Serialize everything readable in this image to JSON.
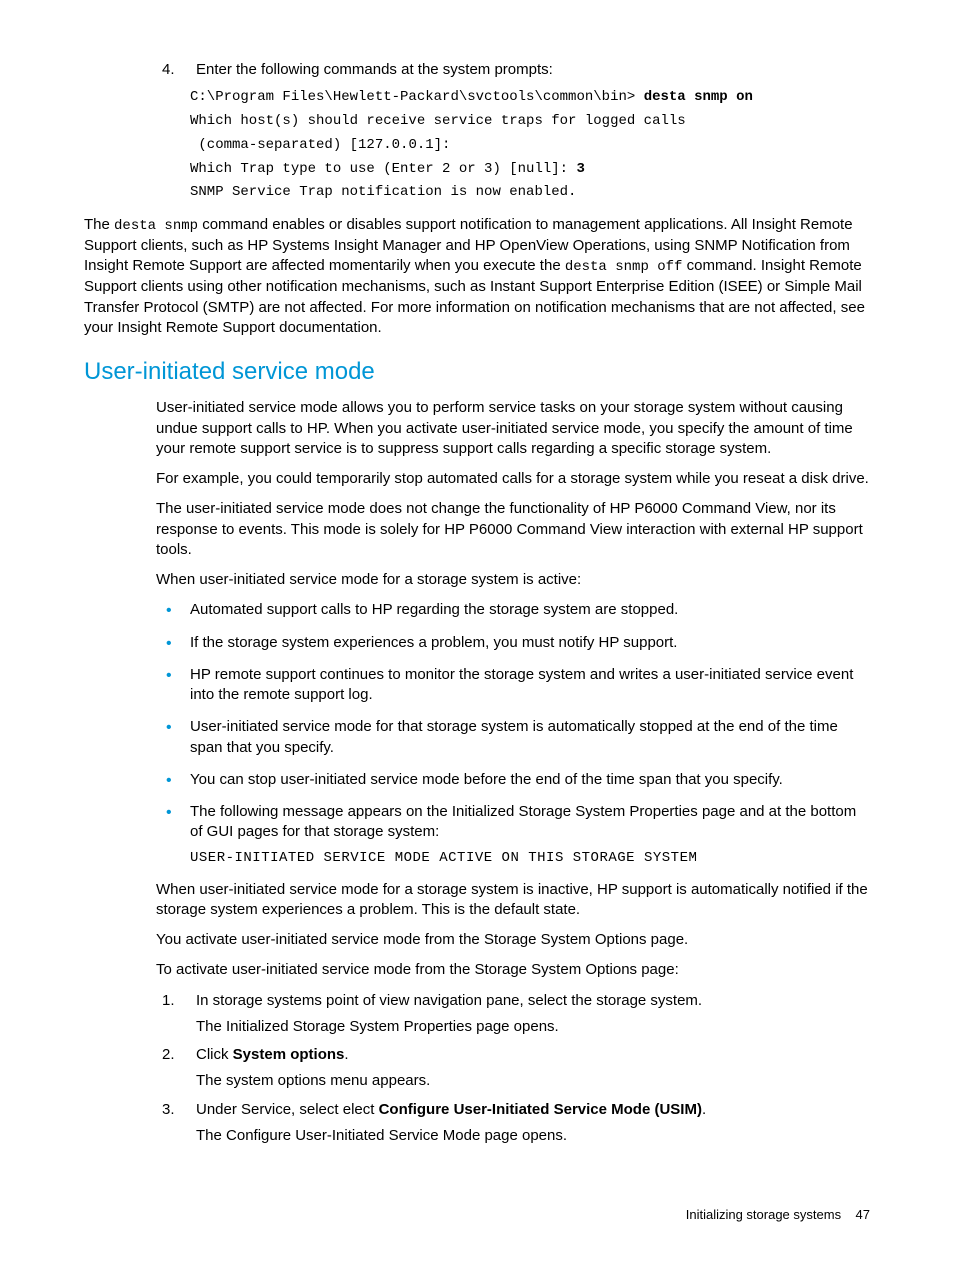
{
  "step4": {
    "num": "4.",
    "text": "Enter the following commands at the system prompts:",
    "code_prompt": "C:\\Program Files\\Hewlett-Packard\\svctools\\common\\bin> ",
    "code_cmd": "desta snmp on",
    "code_line2a": "Which host(s) should receive service traps for logged calls",
    "code_line2b": "(comma-separated) [127.0.0.1]:",
    "code_line3a": "Which Trap type to use (Enter 2 or 3) [null]: ",
    "code_line3b": "3",
    "code_line4": "SNMP Service Trap notification is now enabled."
  },
  "para_desta_1": "The ",
  "para_desta_code1": "desta snmp",
  "para_desta_2": " command enables or disables support notification to management applications. All Insight Remote Support clients, such as HP Systems Insight Manager and HP OpenView Operations, using SNMP Notification from Insight Remote Support are affected momentarily when you execute the ",
  "para_desta_code2": "desta snmp off",
  "para_desta_3": " command. Insight Remote Support clients using other notification mechanisms, such as Instant Support Enterprise Edition (ISEE) or Simple Mail Transfer Protocol (SMTP) are not affected. For more information on notification mechanisms that are not affected, see your Insight Remote Support documentation.",
  "h2": "User-initiated service mode",
  "usim_p1": "User-initiated service mode allows you to perform service tasks on your storage system without causing undue support calls to HP. When you activate user-initiated service mode, you specify the amount of time your remote support service is to suppress support calls regarding a specific storage system.",
  "usim_p2": "For example, you could temporarily stop automated calls for a storage system while you reseat a disk drive.",
  "usim_p3": "The user-initiated service mode does not change the functionality of HP P6000 Command View, nor its response to events. This mode is solely for HP P6000 Command View interaction with external HP support tools.",
  "usim_p4": "When user-initiated service mode for a storage system is active:",
  "bullets": [
    "Automated support calls to HP regarding the storage system are stopped.",
    "If the storage system experiences a problem, you must notify HP support.",
    "HP remote support continues to monitor the storage system and writes a user-initiated service event into the remote support log.",
    "User-initiated service mode for that storage system is automatically stopped at the end of the time span that you specify.",
    "You can stop user-initiated service mode before the end of the time span that you specify."
  ],
  "bullet6_text": "The following message appears on the Initialized Storage System Properties page and at the bottom of GUI pages for that storage system:",
  "bullet6_msg": "USER-INITIATED SERVICE MODE ACTIVE ON THIS STORAGE SYSTEM",
  "usim_p5": "When user-initiated service mode for a storage system is inactive, HP support is automatically notified if the storage system experiences a problem. This is the default state.",
  "usim_p6": "You activate user-initiated service mode from the Storage System Options page.",
  "usim_p7": "To activate user-initiated service mode from the Storage System Options page:",
  "steps": {
    "s1": {
      "num": "1.",
      "t1": "In storage systems point of view navigation pane, select the storage system.",
      "t2": "The Initialized Storage System Properties page opens."
    },
    "s2": {
      "num": "2.",
      "t1a": "Click ",
      "t1b": "System options",
      "t1c": ".",
      "t2": "The system options menu appears."
    },
    "s3": {
      "num": "3.",
      "t1a": "Under Service, select elect ",
      "t1b": "Configure User-Initiated Service Mode (USIM)",
      "t1c": ".",
      "t2": "The Configure User-Initiated Service Mode page opens."
    }
  },
  "footer_text": "Initializing storage systems",
  "footer_page": "47"
}
